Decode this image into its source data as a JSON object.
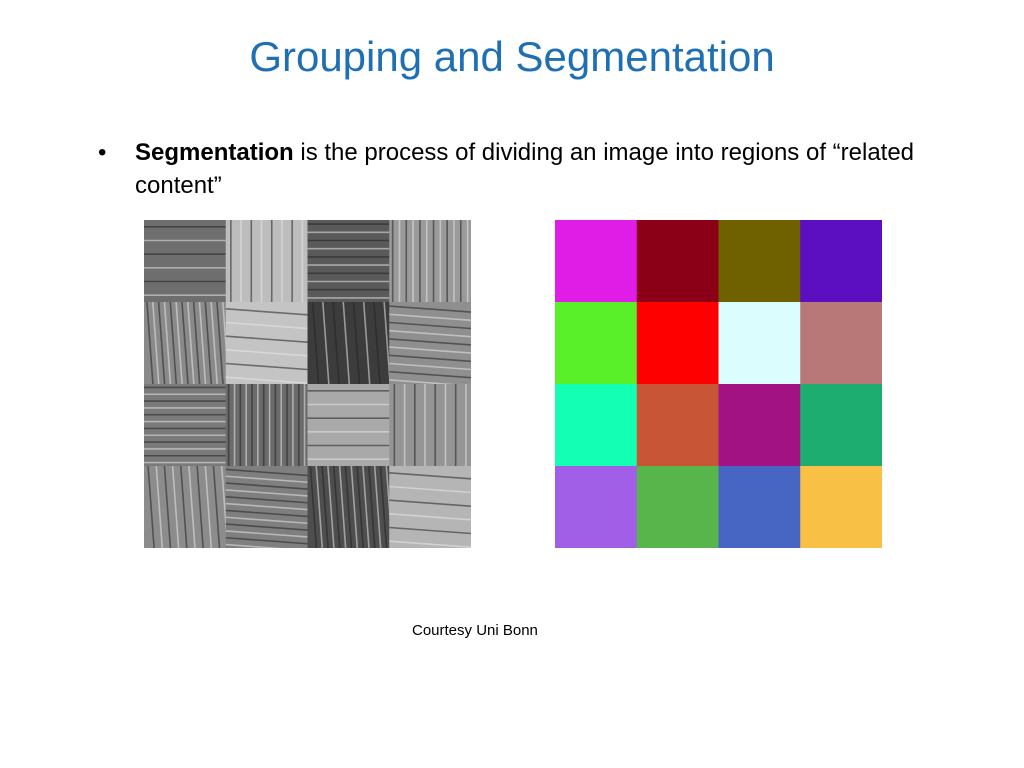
{
  "slide": {
    "title": "Grouping and Segmentation",
    "bullet": {
      "marker": "•",
      "term": "Segmentation",
      "text": " is the process of dividing an image into regions of “related content”"
    },
    "caption": "Courtesy Uni Bonn"
  },
  "figures": {
    "texture_mosaic": {
      "grid": [
        4,
        4
      ],
      "tile_tones": [
        [
          "#6e6e6e",
          "#bdbdbd",
          "#5a5a5a",
          "#9a9a9a"
        ],
        [
          "#8a8a8a",
          "#c4c4c4",
          "#3c3c3c",
          "#8f8f8f"
        ],
        [
          "#7a7a7a",
          "#6b6b6b",
          "#a9a9a9",
          "#959595"
        ],
        [
          "#8c8c8c",
          "#7f7f7f",
          "#4e4e4e",
          "#b5b5b5"
        ]
      ]
    },
    "segmentation_map": {
      "grid": [
        4,
        4
      ],
      "region_colors": [
        [
          "#e01de6",
          "#8b0016",
          "#6f6100",
          "#5b0fc0"
        ],
        [
          "#59f02a",
          "#ff0000",
          "#dcfdfd",
          "#b87878"
        ],
        [
          "#13ffb4",
          "#c85636",
          "#a21283",
          "#1ead70"
        ],
        [
          "#a05fe6",
          "#58b54c",
          "#4766c3",
          "#f9c046"
        ]
      ]
    }
  }
}
